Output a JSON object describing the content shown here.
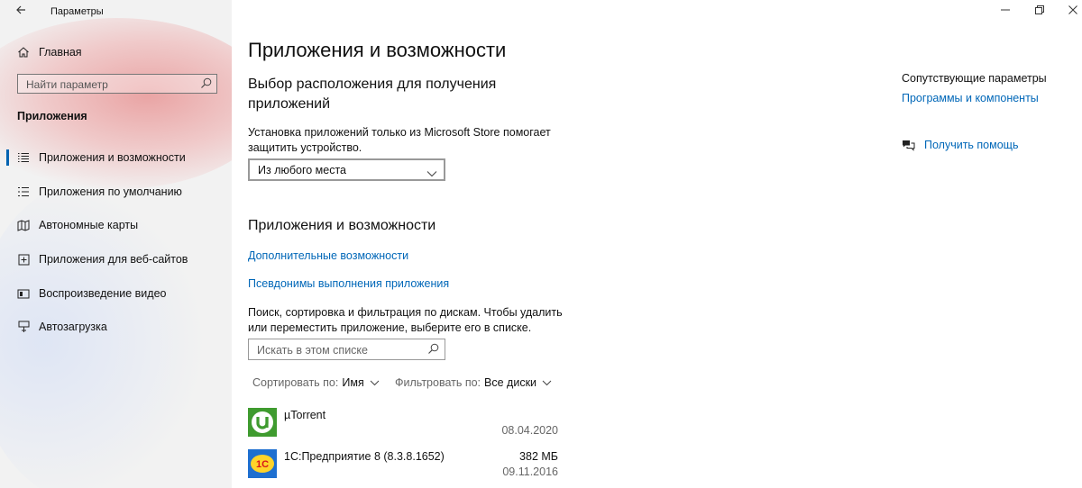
{
  "window": {
    "title": "Параметры"
  },
  "sidebar": {
    "home_label": "Главная",
    "search_placeholder": "Найти параметр",
    "section_title": "Приложения",
    "items": [
      {
        "label": "Приложения и возможности",
        "icon": "apps-features-icon",
        "active": true
      },
      {
        "label": "Приложения по умолчанию",
        "icon": "default-apps-icon"
      },
      {
        "label": "Автономные карты",
        "icon": "offline-maps-icon"
      },
      {
        "label": "Приложения для веб-сайтов",
        "icon": "apps-for-websites-icon"
      },
      {
        "label": "Воспроизведение видео",
        "icon": "video-playback-icon"
      },
      {
        "label": "Автозагрузка",
        "icon": "startup-icon"
      }
    ]
  },
  "main": {
    "title": "Приложения и возможности",
    "install_section": {
      "heading": "Выбор расположения для получения приложений",
      "description": "Установка приложений только из Microsoft Store помогает защитить устройство.",
      "select_value": "Из любого места"
    },
    "apps_section": {
      "heading": "Приложения и возможности",
      "link_optional": "Дополнительные возможности",
      "link_aliases": "Псевдонимы выполнения приложения",
      "description": "Поиск, сортировка и фильтрация по дискам. Чтобы удалить или переместить приложение, выберите его в списке.",
      "search_placeholder": "Искать в этом списке",
      "sort_label": "Сортировать по:",
      "sort_value": "Имя",
      "filter_label": "Фильтровать по:",
      "filter_value": "Все диски"
    },
    "apps": [
      {
        "name": "µTorrent",
        "size": "",
        "date": "08.04.2020",
        "icon": "utorrent-icon"
      },
      {
        "name": "1С:Предприятие 8 (8.3.8.1652)",
        "size": "382 МБ",
        "date": "09.11.2016",
        "icon": "1c-icon"
      }
    ]
  },
  "related": {
    "heading": "Сопутствующие параметры",
    "programs_link": "Программы и компоненты",
    "help_link": "Получить помощь"
  },
  "colors": {
    "accent": "#0067b8",
    "active_bar": "#0063b1"
  }
}
